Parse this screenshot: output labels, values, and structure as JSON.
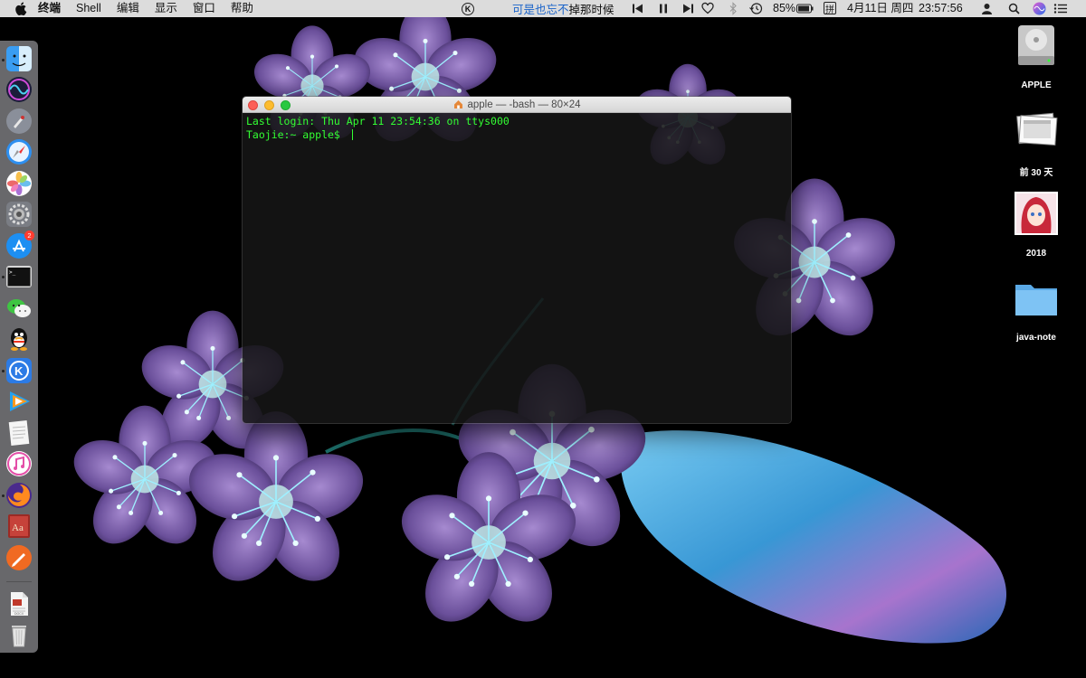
{
  "menubar": {
    "app_name": "终端",
    "menus": [
      "Shell",
      "编辑",
      "显示",
      "窗口",
      "帮助"
    ],
    "now_playing_part1": "可是也忘不",
    "now_playing_part2": "掉那时候",
    "battery": "85%",
    "input_method": "拼",
    "date": "4月11日 周四",
    "time": "23:57:56"
  },
  "terminal": {
    "title": "apple — -bash — 80×24",
    "lines": [
      "Last login: Thu Apr 11 23:54:36 on ttys000",
      "Taojie:~ apple$ "
    ]
  },
  "desktop": {
    "icons": [
      {
        "label": "APPLE",
        "icon": "hard-drive-icon"
      },
      {
        "label": "前 30 天",
        "icon": "screenshot-stack-icon"
      },
      {
        "label": "2018",
        "icon": "anime-image-icon"
      },
      {
        "label": "java-note",
        "icon": "folder-icon"
      }
    ]
  },
  "dock": {
    "items": [
      {
        "name": "finder",
        "badge": ""
      },
      {
        "name": "siri",
        "badge": ""
      },
      {
        "name": "launchpad",
        "badge": ""
      },
      {
        "name": "safari",
        "badge": ""
      },
      {
        "name": "photos",
        "badge": ""
      },
      {
        "name": "system-preferences",
        "badge": ""
      },
      {
        "name": "app-store",
        "badge": "2"
      },
      {
        "name": "terminal",
        "badge": ""
      },
      {
        "name": "wechat",
        "badge": ""
      },
      {
        "name": "qq",
        "badge": ""
      },
      {
        "name": "kugou",
        "badge": ""
      },
      {
        "name": "tencent-video",
        "badge": ""
      },
      {
        "name": "textedit",
        "badge": ""
      },
      {
        "name": "itunes",
        "badge": ""
      },
      {
        "name": "firefox",
        "badge": ""
      },
      {
        "name": "dictionary",
        "badge": ""
      },
      {
        "name": "pencil-app",
        "badge": ""
      },
      {
        "name": "docx-document",
        "badge": ""
      },
      {
        "name": "trash",
        "badge": ""
      }
    ]
  },
  "colors": {
    "terminal_text": "#33ff33",
    "menubar_bg": "#dcdcdc",
    "lyric_highlight": "#1a63c9"
  }
}
